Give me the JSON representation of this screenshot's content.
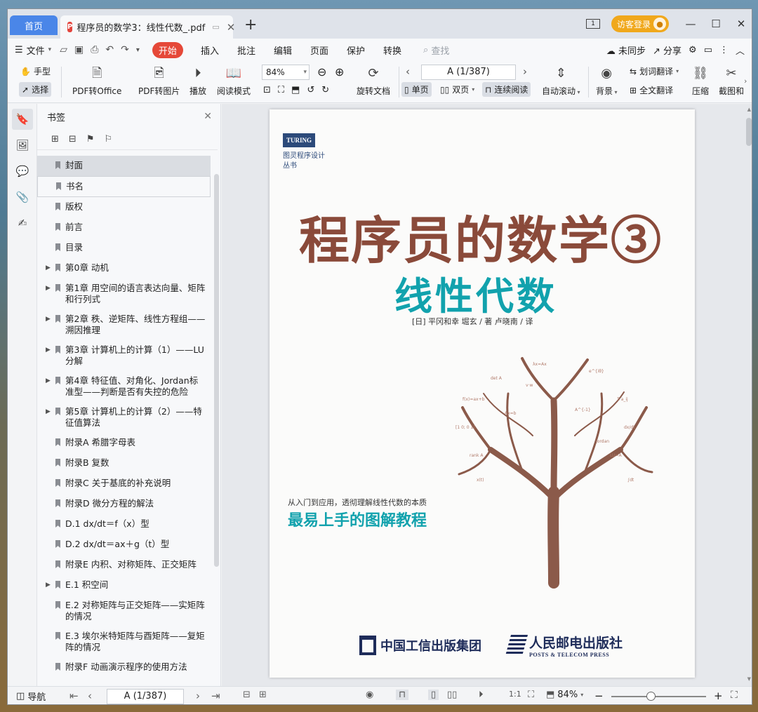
{
  "tabs": {
    "home": "首页",
    "doc_title": "程序员的数学3：线性代数_.pdf",
    "add": "+"
  },
  "window": {
    "login": "访客登录"
  },
  "menu": {
    "file": "文件",
    "start": "开始",
    "items": [
      "插入",
      "批注",
      "编辑",
      "页面",
      "保护",
      "转换"
    ],
    "search": "查找",
    "sync": "未同步",
    "share": "分享"
  },
  "toolbar": {
    "hand": "手型",
    "select": "选择",
    "pdf_to_office": "PDF转Office",
    "pdf_to_image": "PDF转图片",
    "play": "播放",
    "read_mode": "阅读模式",
    "zoom": "84%",
    "rotate": "旋转文档",
    "page": "A (1/387)",
    "single": "单页",
    "double": "双页",
    "continuous": "连续阅读",
    "auto_scroll": "自动滚动",
    "background": "背景",
    "word_translate": "划词翻译",
    "full_translate": "全文翻译",
    "compress": "压缩",
    "screenshot": "截图和"
  },
  "bookmarks": {
    "title": "书签",
    "items": [
      {
        "label": "封面",
        "arrow": false
      },
      {
        "label": "书名",
        "arrow": false
      },
      {
        "label": "版权",
        "arrow": false
      },
      {
        "label": "前言",
        "arrow": false
      },
      {
        "label": "目录",
        "arrow": false
      },
      {
        "label": "第0章 动机",
        "arrow": true
      },
      {
        "label": "第1章 用空间的语言表达向量、矩阵和行列式",
        "arrow": true
      },
      {
        "label": "第2章 秩、逆矩阵、线性方程组——溯因推理",
        "arrow": true
      },
      {
        "label": "第3章 计算机上的计算（1）——LU分解",
        "arrow": true
      },
      {
        "label": "第4章 特征值、对角化、Jordan标准型——判断是否有失控的危险",
        "arrow": true
      },
      {
        "label": "第5章 计算机上的计算（2）——特征值算法",
        "arrow": true
      },
      {
        "label": "附录A 希腊字母表",
        "arrow": false
      },
      {
        "label": "附录B 复数",
        "arrow": false
      },
      {
        "label": "附录C 关于基底的补充说明",
        "arrow": false
      },
      {
        "label": "附录D 微分方程的解法",
        "arrow": false
      },
      {
        "label": "D.1 dx/dt＝f（x）型",
        "arrow": false
      },
      {
        "label": "D.2 dx/dt＝ax＋g（t）型",
        "arrow": false
      },
      {
        "label": "附录E 内积、对称矩阵、正交矩阵",
        "arrow": false
      },
      {
        "label": "E.1 积空间",
        "arrow": true
      },
      {
        "label": "E.2 对称矩阵与正交矩阵——实矩阵的情况",
        "arrow": false
      },
      {
        "label": "E.3 埃尔米特矩阵与酉矩阵——复矩阵的情况",
        "arrow": false
      },
      {
        "label": "附录F 动画演示程序的使用方法",
        "arrow": false
      }
    ]
  },
  "cover": {
    "logo": "TURING",
    "series": "图灵程序设计丛书",
    "title": "程序员的数学③",
    "subtitle": "线性代数",
    "authors": "[日] 平冈和幸  堀玄 / 著  卢晓南 / 译",
    "tagline": "从入门到应用，透彻理解线性代数的本质",
    "tagline_big": "最易上手的图解教程",
    "publisher1": "中国工信出版集团",
    "publisher2_cn": "人民邮电出版社",
    "publisher2_en": "POSTS & TELECOM PRESS"
  },
  "status": {
    "nav": "导航",
    "page": "A (1/387)",
    "zoom": "84%"
  },
  "colors": {
    "accent": "#4a86e8",
    "start": "#e54838",
    "login": "#f0a81c",
    "cover_title": "#8a4a3a",
    "cover_teal": "#12a2ad"
  }
}
